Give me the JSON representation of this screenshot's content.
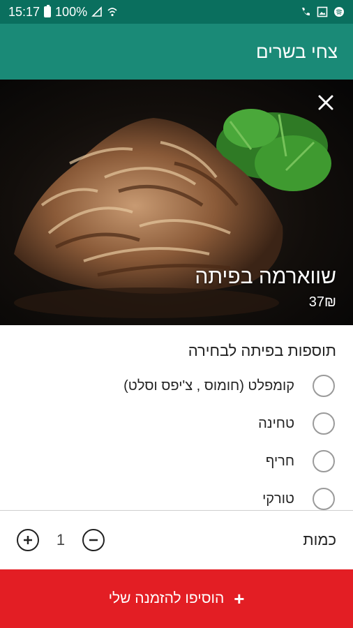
{
  "status_bar": {
    "time": "15:17",
    "battery": "100%",
    "icons": [
      "battery-icon",
      "signal-icon",
      "wifi-icon",
      "call-icon",
      "gallery-icon",
      "spotify-icon"
    ]
  },
  "app_bar": {
    "title": "צחי בשרים",
    "background": "#1a8a77"
  },
  "dish": {
    "name": "שווארמה בפיתה",
    "price": "37₪"
  },
  "options": {
    "title": "תוספות בפיתה לבחירה",
    "items": [
      {
        "label": "קומפלט (חומוס , צ'יפס וסלט)"
      },
      {
        "label": "טחינה"
      },
      {
        "label": "חריף"
      },
      {
        "label": "טורקי"
      }
    ]
  },
  "quantity": {
    "label": "כמות",
    "value": "1"
  },
  "add_button": {
    "label": "הוסיפו להזמנה שלי",
    "background": "#e31e24"
  }
}
